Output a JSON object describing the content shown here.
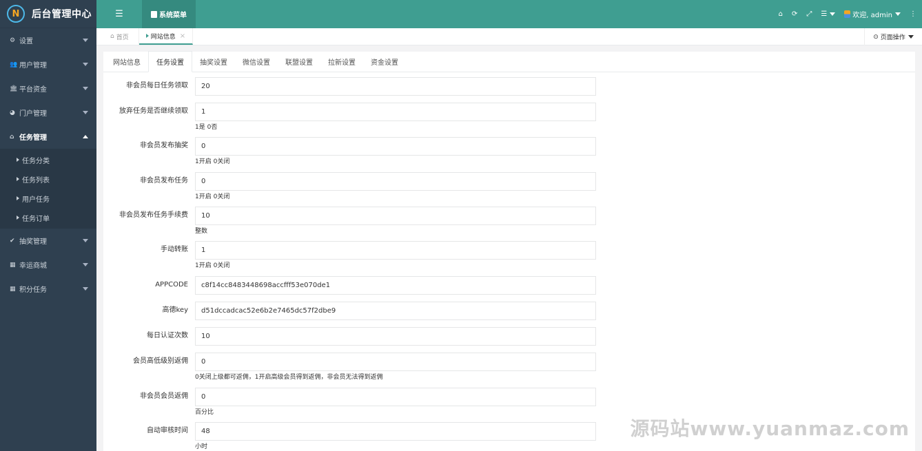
{
  "app": {
    "title": "后台管理中心",
    "logo_glyph": "N"
  },
  "sidebar": {
    "items": [
      {
        "label": "设置",
        "icon": "gears-icon"
      },
      {
        "label": "用户管理",
        "icon": "users-icon"
      },
      {
        "label": "平台资金",
        "icon": "bank-icon"
      },
      {
        "label": "门户管理",
        "icon": "pie-icon"
      },
      {
        "label": "任务管理",
        "icon": "home-icon",
        "active": true
      },
      {
        "label": "抽奖管理",
        "icon": "check-circle-icon"
      },
      {
        "label": "幸运商城",
        "icon": "shop-icon"
      },
      {
        "label": "积分任务",
        "icon": "grid-icon"
      }
    ],
    "submenu": [
      "任务分类",
      "任务列表",
      "用户任务",
      "任务订单"
    ]
  },
  "topbar": {
    "system_menu": "系统菜单",
    "welcome": "欢迎, admin"
  },
  "page_tabs": {
    "home": "首页",
    "current": "网站信息",
    "page_ops": "页面操作"
  },
  "content_tabs": [
    "网站信息",
    "任务设置",
    "抽奖设置",
    "微信设置",
    "联盟设置",
    "拉新设置",
    "资金设置"
  ],
  "active_content_tab": "任务设置",
  "fields": [
    {
      "label": "非会员每日任务领取",
      "value": "20",
      "hint": ""
    },
    {
      "label": "放弃任务是否继续领取",
      "value": "1",
      "hint": "1是 0否"
    },
    {
      "label": "非会员发布抽奖",
      "value": "0",
      "hint": "1开启 0关闭"
    },
    {
      "label": "非会员发布任务",
      "value": "0",
      "hint": "1开启 0关闭"
    },
    {
      "label": "非会员发布任务手续费",
      "value": "10",
      "hint": "整数"
    },
    {
      "label": "手动转账",
      "value": "1",
      "hint": "1开启 0关闭"
    },
    {
      "label": "APPCODE",
      "value": "c8f14cc8483448698accfff53e070de1",
      "hint": ""
    },
    {
      "label": "高德key",
      "value": "d51dccadcac52e6b2e7465dc57f2dbe9",
      "hint": ""
    },
    {
      "label": "每日认证次数",
      "value": "10",
      "hint": ""
    },
    {
      "label": "会员高低级别返佣",
      "value": "0",
      "hint": "0关闭上级都可返佣，1开启高级会员得到返佣，非会员无法得到返佣"
    },
    {
      "label": "非会员会员返佣",
      "value": "0",
      "hint": "百分比"
    },
    {
      "label": "自动审核时间",
      "value": "48",
      "hint": "小时"
    }
  ],
  "watermark": "源码站www.yuanmaz.com",
  "colors": {
    "sidebar": "#2f4050",
    "header": "#3f9e91",
    "accent": "#3f9e91"
  }
}
